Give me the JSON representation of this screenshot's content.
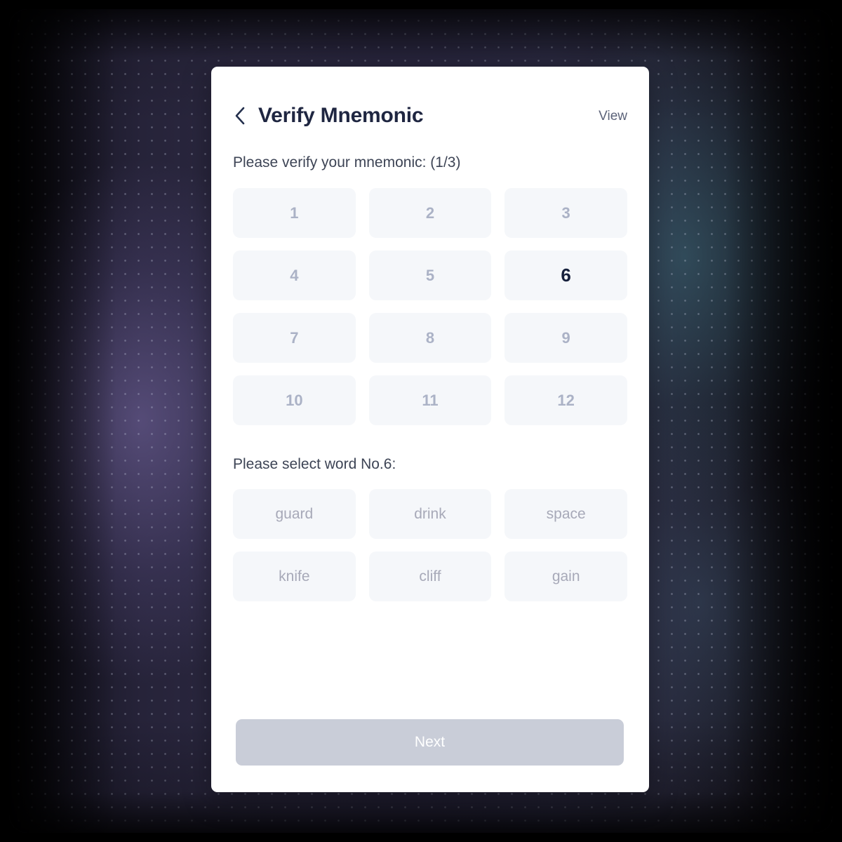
{
  "header": {
    "back_icon": "chevron-left-icon",
    "title": "Verify Mnemonic",
    "view_label": "View"
  },
  "instructions": {
    "verify": "Please verify your mnemonic: (1/3)",
    "select": "Please select word No.6:"
  },
  "number_grid": {
    "tiles": [
      {
        "label": "1",
        "active": false
      },
      {
        "label": "2",
        "active": false
      },
      {
        "label": "3",
        "active": false
      },
      {
        "label": "4",
        "active": false
      },
      {
        "label": "5",
        "active": false
      },
      {
        "label": "6",
        "active": true
      },
      {
        "label": "7",
        "active": false
      },
      {
        "label": "8",
        "active": false
      },
      {
        "label": "9",
        "active": false
      },
      {
        "label": "10",
        "active": false
      },
      {
        "label": "11",
        "active": false
      },
      {
        "label": "12",
        "active": false
      }
    ]
  },
  "word_grid": {
    "tiles": [
      {
        "label": "guard"
      },
      {
        "label": "drink"
      },
      {
        "label": "space"
      },
      {
        "label": "knife"
      },
      {
        "label": "cliff"
      },
      {
        "label": "gain"
      }
    ]
  },
  "footer": {
    "next_label": "Next",
    "next_enabled": false
  },
  "colors": {
    "card_background": "#ffffff",
    "title_text": "#1f2641",
    "instruction_text": "#3d4455",
    "tile_background": "#f5f7fa",
    "tile_number_text": "#abb2c6",
    "tile_number_active_text": "#16203c",
    "tile_word_text": "#a7a9b8",
    "next_button_background": "#c9cdd8",
    "next_button_text": "#ffffff",
    "page_background": "#2a2740"
  }
}
